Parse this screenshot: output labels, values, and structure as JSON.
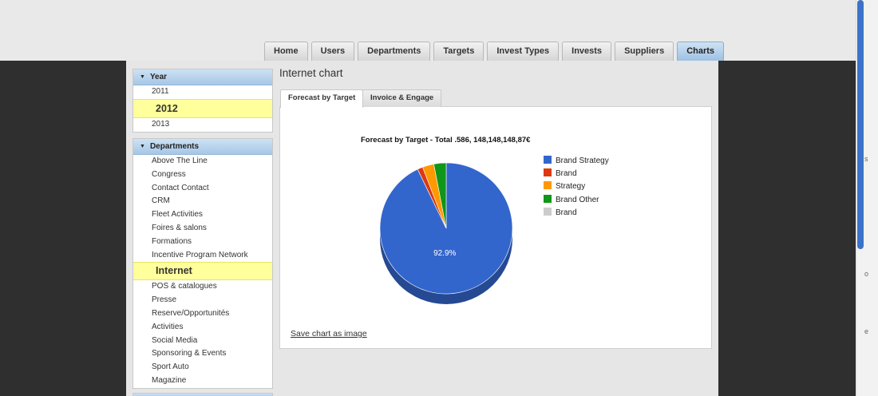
{
  "nav": {
    "tabs": [
      {
        "label": "Home",
        "active": false
      },
      {
        "label": "Users",
        "active": false
      },
      {
        "label": "Departments",
        "active": false
      },
      {
        "label": "Targets",
        "active": false
      },
      {
        "label": "Invest Types",
        "active": false
      },
      {
        "label": "Invests",
        "active": false
      },
      {
        "label": "Suppliers",
        "active": false
      },
      {
        "label": "Charts",
        "active": true
      }
    ]
  },
  "sidebar": {
    "year": {
      "title": "Year",
      "items": [
        "2011",
        "2012",
        "2013"
      ],
      "selected": "2012"
    },
    "departments": {
      "title": "Departments",
      "items": [
        "Above The Line",
        "Congress",
        "Contact Contact",
        "CRM",
        "Fleet Activities",
        "Foires & salons",
        "Formations",
        "Incentive Program Network",
        "Internet",
        "POS & catalogues",
        "Presse",
        "Reserve/Opportunités",
        "Activities",
        "Social Media",
        "Sponsoring & Events",
        "Sport Auto",
        "Magazine"
      ],
      "selected": "Internet"
    }
  },
  "main": {
    "title": "Internet chart",
    "tabs": [
      {
        "label": "Forecast by Target",
        "active": true
      },
      {
        "label": "Invoice & Engage",
        "active": false
      }
    ],
    "save_link": "Save chart as image"
  },
  "colors": {
    "accent_tab": "#9dc1e3",
    "highlight": "#ffff9c"
  },
  "chart_data": {
    "type": "pie",
    "title": "Forecast by Target - Total .586, 148,148,148,87€",
    "categories": [
      "Brand Strategy",
      "Brand",
      "Strategy",
      "Brand  Other",
      "Brand"
    ],
    "values": [
      92.9,
      1.3,
      2.8,
      3.0,
      0.0
    ],
    "colors": [
      "#3366cc",
      "#dc3912",
      "#ff9900",
      "#109618",
      "#cccccc"
    ],
    "data_labels": [
      "92.9%",
      "",
      "",
      "",
      ""
    ],
    "legend": "right",
    "style": "3d"
  }
}
